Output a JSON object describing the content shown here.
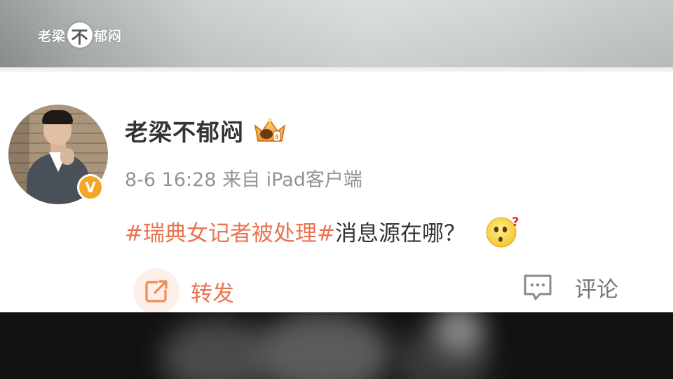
{
  "watermark": {
    "left_text": "老梁",
    "circle_text": "不",
    "right_text": "郁闷"
  },
  "post": {
    "username": "老梁不郁闷",
    "meta": "8-6 16:28  来自 iPad客户端",
    "hashtag": "#瑞典女记者被处理#",
    "body_text": "消息源在哪？",
    "verified_badge": "V",
    "emoji_icon": "confused-face-question-icon",
    "crown_icon": "crown-badge-icon"
  },
  "actions": {
    "repost_label": "转发",
    "comment_label": "评论"
  },
  "colors": {
    "hashtag": "#eb7350",
    "verified": "#f5a623",
    "text": "#333333",
    "meta": "#939393"
  }
}
